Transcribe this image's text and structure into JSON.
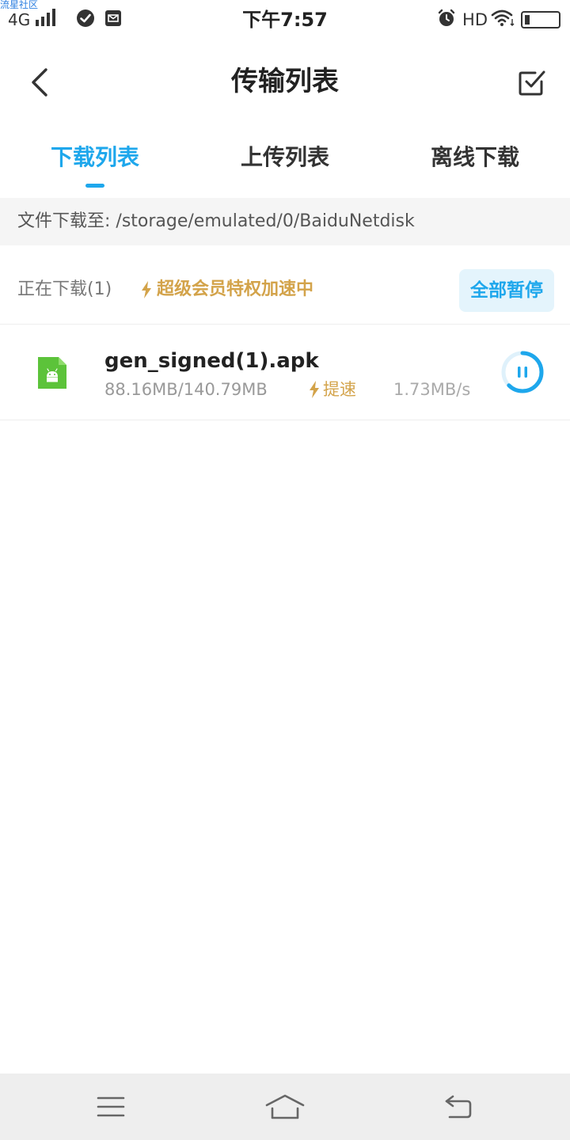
{
  "status_bar": {
    "watermark": "流星社区",
    "network": "4G",
    "time": "下午7:57",
    "hd": "HD"
  },
  "header": {
    "title": "传输列表"
  },
  "tabs": [
    {
      "label": "下载列表",
      "active": true
    },
    {
      "label": "上传列表",
      "active": false
    },
    {
      "label": "离线下载",
      "active": false
    }
  ],
  "path": {
    "label": "文件下载至: /storage/emulated/0/BaiduNetdisk"
  },
  "section": {
    "status": "正在下载(1)",
    "vip_text": "超级会员特权加速中",
    "pause_all_label": "全部暂停"
  },
  "downloads": [
    {
      "name": "gen_signed(1).apk",
      "size": "88.16MB/140.79MB",
      "boost_label": "提速",
      "speed": "1.73MB/s",
      "progress": 0.626
    }
  ],
  "colors": {
    "accent": "#1ea7ec",
    "gold": "#d3a34a",
    "apk_green": "#5cc33a"
  },
  "icons": {
    "back": "chevron-left-icon",
    "select": "checkbox-icon",
    "pause": "pause-icon",
    "file": "android-file-icon"
  }
}
